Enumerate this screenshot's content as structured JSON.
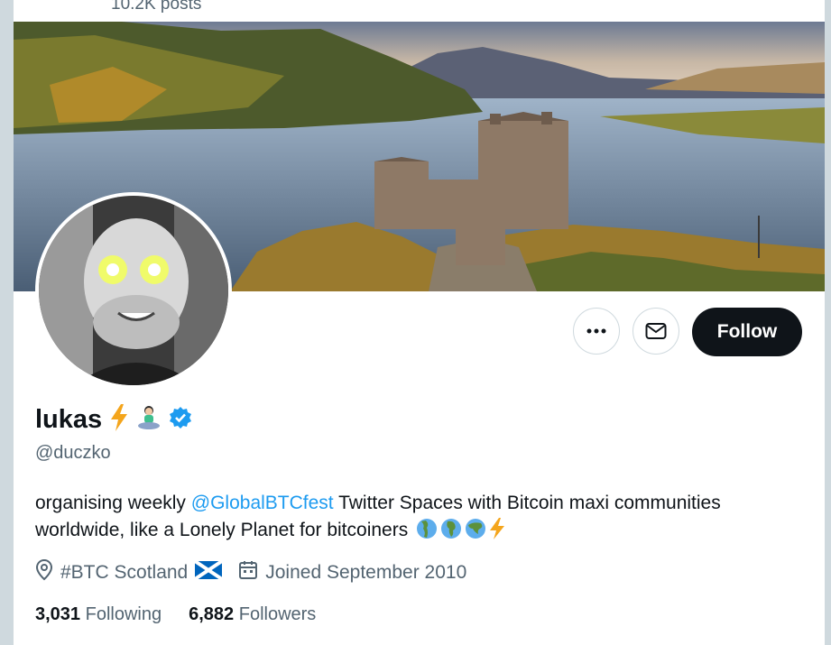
{
  "header": {
    "posts_count": "10.2K posts"
  },
  "profile": {
    "display_name": "lukas",
    "handle": "@duczko",
    "bio_prefix": "organising weekly ",
    "bio_mention": "@GlobalBTCfest",
    "bio_line1_rest": " Twitter Spaces with Bitcoin maxi communities",
    "bio_line2": "worldwide, like a Lonely Planet for bitcoiners",
    "location": "#BTC Scotland",
    "joined": "Joined September 2010"
  },
  "actions": {
    "follow_label": "Follow"
  },
  "stats": {
    "following_count": "3,031",
    "following_label": "Following",
    "followers_count": "6,882",
    "followers_label": "Followers"
  },
  "icons": {
    "more": "more-dots-icon",
    "message": "envelope-icon",
    "verified": "verified-badge-icon",
    "location": "location-pin-icon",
    "calendar": "calendar-icon"
  },
  "colors": {
    "accent": "#1d9bf0",
    "text": "#0f1419",
    "muted": "#536471",
    "button_dark": "#0f1419"
  }
}
